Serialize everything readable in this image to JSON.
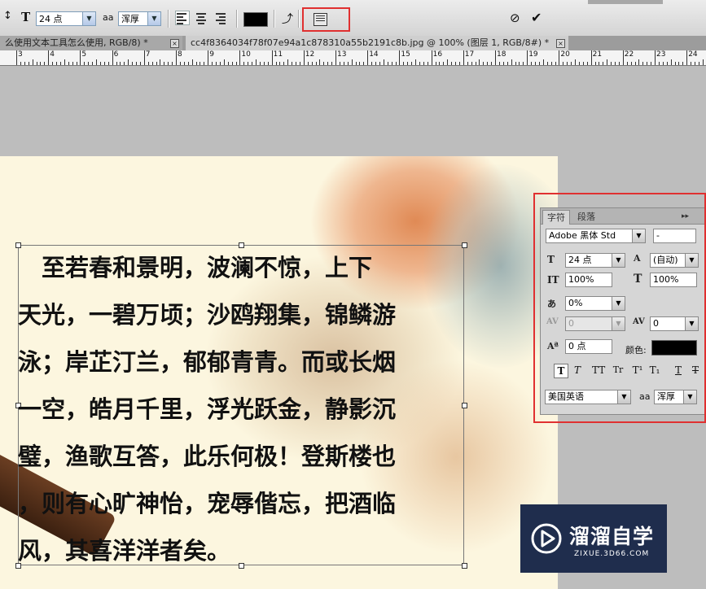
{
  "options_bar": {
    "font_size": "24 点",
    "antialias_icon": "aa",
    "antialias": "浑厚",
    "commit_icon": "checkmark-icon",
    "cancel_icon": "cancel-icon",
    "color_swatch": "#000000"
  },
  "tabs": [
    {
      "label": "么使用文本工具怎么使用, RGB/8) *",
      "close": "×"
    },
    {
      "label": "cc4f8364034f78f07e94a1c878310a55b2191c8b.jpg @ 100% (图层 1, RGB/8#) *",
      "close": "×"
    }
  ],
  "ruler": {
    "labels": [
      "3",
      "4",
      "5",
      "6",
      "7",
      "8",
      "9",
      "10",
      "11",
      "12",
      "13",
      "14",
      "15",
      "16",
      "17",
      "18",
      "19",
      "20",
      "21",
      "22",
      "23",
      "24"
    ]
  },
  "poem": {
    "lines": [
      "　至若春和景明，波澜不惊，上下",
      "天光，一碧万顷；沙鸥翔集，锦鳞游",
      "泳；岸芷汀兰，郁郁青青。而或长烟",
      "一空，皓月千里，浮光跃金，静影沉",
      "璧，渔歌互答，此乐何极！登斯楼也",
      "，则有心旷神怡，宠辱偕忘，把酒临",
      "风，其喜洋洋者矣。"
    ]
  },
  "character_panel": {
    "tab_character": "字符",
    "tab_paragraph": "段落",
    "menu": "▸▸",
    "font_family": "Adobe 黑体 Std",
    "font_style": "-",
    "font_size": "24 点",
    "leading": "(自动)",
    "vertical_scale": "100%",
    "horizontal_scale": "100%",
    "tsume": "0%",
    "kerning": "0",
    "tracking": "0",
    "baseline_shift": "0 点",
    "color_label": "颜色:",
    "color": "#000000",
    "language": "美国英语",
    "antialias_icon": "aa",
    "antialias": "浑厚",
    "style_buttons": [
      "T",
      "T",
      "TT",
      "Tr",
      "T¹",
      "T₁",
      "T",
      "T"
    ]
  },
  "watermark": {
    "title": "溜溜自学",
    "url": "ZIXUE.3D66.COM"
  }
}
